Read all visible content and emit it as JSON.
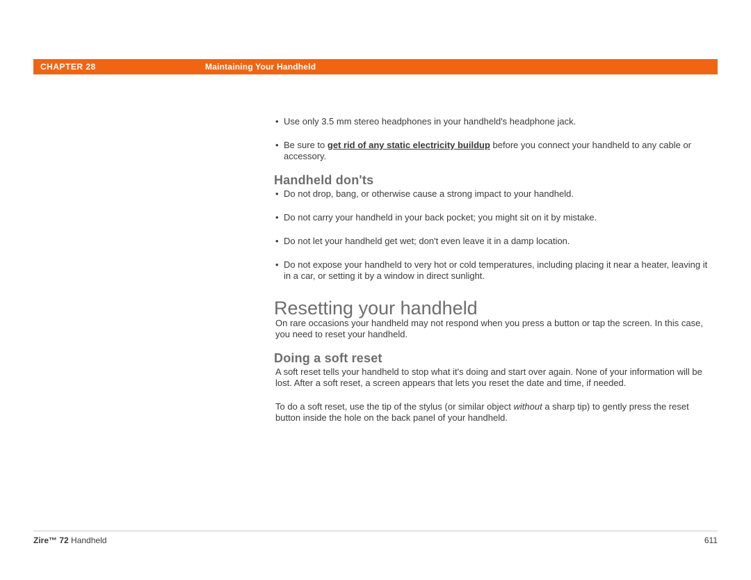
{
  "header": {
    "chapter_label": "CHAPTER 28",
    "chapter_title": "Maintaining Your Handheld"
  },
  "tips": {
    "items": [
      {
        "text_a": "Use only 3.5 mm stereo headphones in your handheld's headphone jack."
      },
      {
        "text_a": "Be sure to ",
        "link": "get rid of any static electricity buildup",
        "text_b": " before you connect your handheld to any cable or accessory."
      }
    ]
  },
  "donts": {
    "heading": "Handheld don'ts",
    "items": [
      "Do not drop, bang, or otherwise cause a strong impact to your handheld.",
      "Do not carry your handheld in your back pocket; you might sit on it by mistake.",
      "Do not let your handheld get wet; don't even leave it in a damp location.",
      "Do not expose your handheld to very hot or cold temperatures, including placing it near a heater, leaving it in a car, or setting it by a window in direct sunlight."
    ]
  },
  "reset": {
    "heading": "Resetting your handheld",
    "intro": "On rare occasions your handheld may not respond when you press a button or tap the screen. In this case, you need to reset your handheld."
  },
  "soft": {
    "heading": "Doing a soft reset",
    "p1": "A soft reset tells your handheld to stop what it's doing and start over again. None of your information will be lost. After a soft reset, a screen appears that lets you reset the date and time, if needed.",
    "p2_a": "To do a soft reset, use the tip of the stylus (or similar object ",
    "p2_i": "without",
    "p2_b": " a sharp tip) to gently press the reset button inside the hole on the back panel of your handheld."
  },
  "footer": {
    "product_b": "Zire™ 72",
    "product_r": " Handheld",
    "page": "611"
  }
}
